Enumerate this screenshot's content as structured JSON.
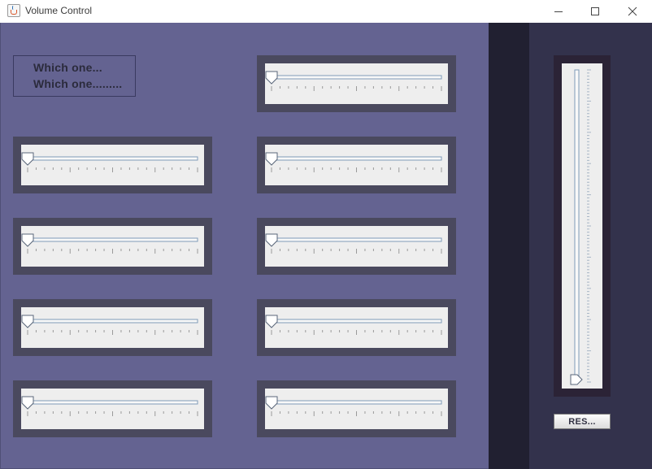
{
  "window": {
    "title": "Volume Control",
    "controls": [
      "minimize-icon",
      "maximize-icon",
      "close-icon"
    ]
  },
  "label_box": {
    "line1": "Which one...",
    "line2": "Which one........."
  },
  "sliders": [
    {
      "id": "slider-1",
      "value": 0
    },
    {
      "id": "slider-2",
      "value": 0
    },
    {
      "id": "slider-3",
      "value": 0
    },
    {
      "id": "slider-4",
      "value": 0
    },
    {
      "id": "slider-5",
      "value": 0
    },
    {
      "id": "slider-6",
      "value": 0
    },
    {
      "id": "slider-7",
      "value": 0
    },
    {
      "id": "slider-8",
      "value": 0
    },
    {
      "id": "slider-9",
      "value": 0
    }
  ],
  "vertical_slider": {
    "value": 0
  },
  "reset_button": {
    "label": "RES..."
  },
  "colors": {
    "main_panel": "#646391",
    "right_panel": "#33324c",
    "divider_strip": "#212031",
    "slider_frame": "#4a495e",
    "slider_track_bg": "#eeeeee",
    "track_line": "#7f9bb8"
  }
}
